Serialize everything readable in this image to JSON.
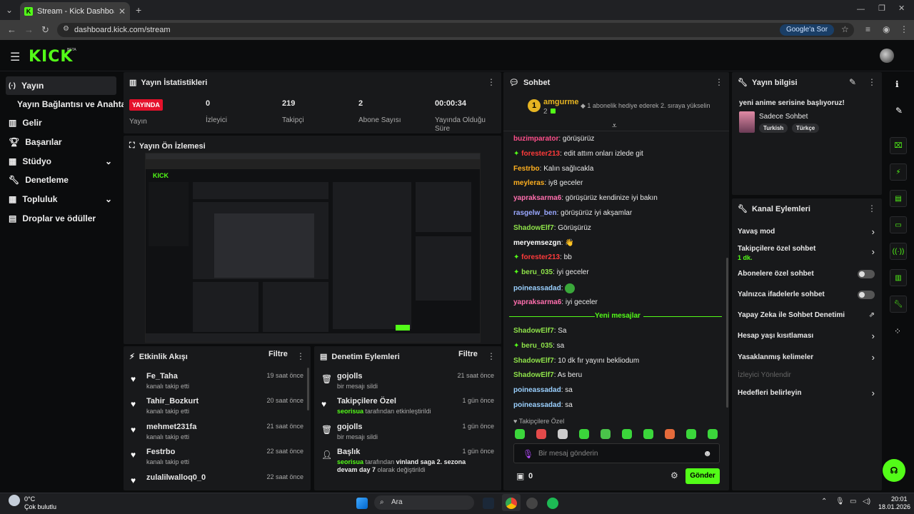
{
  "browser": {
    "tab_title": "Stream - Kick Dashboard",
    "url": "dashboard.kick.com/stream",
    "google_btn": "Google'a Sor"
  },
  "brand": {
    "logo": "KICK",
    "beta": "BETA",
    "accent": "#53fc18"
  },
  "sidebar": {
    "items": [
      {
        "label": "Yayın",
        "icon": "broadcast-icon"
      },
      {
        "label": "Yayın Bağlantısı ve Anahtarı",
        "icon": ""
      },
      {
        "label": "Gelir",
        "icon": "chart-icon"
      },
      {
        "label": "Başarılar",
        "icon": "trophy-icon"
      },
      {
        "label": "Stüdyo",
        "icon": "grid-icon"
      },
      {
        "label": "Denetleme",
        "icon": "wrench-icon"
      },
      {
        "label": "Topluluk",
        "icon": "grid-icon"
      },
      {
        "label": "Droplar ve ödüller",
        "icon": "gift-icon"
      }
    ]
  },
  "stats": {
    "title": "Yayın İstatistikleri",
    "live": "YAYINDA",
    "live_label": "Yayın",
    "viewers": "0",
    "viewers_label": "İzleyici",
    "followers": "219",
    "followers_label": "Takipçi",
    "subs": "2",
    "subs_label": "Abone Sayısı",
    "uptime": "00:00:34",
    "uptime_label": "Yayında Olduğu Süre"
  },
  "preview": {
    "title": "Yayın Ön İzlemesi"
  },
  "activity": {
    "title": "Etkinlik Akışı",
    "filter": "Filtre",
    "items": [
      {
        "name": "Fe_Taha",
        "action": "kanalı takip etti",
        "time": "19 saat önce"
      },
      {
        "name": "Tahir_Bozkurt",
        "action": "kanalı takip etti",
        "time": "20 saat önce"
      },
      {
        "name": "mehmet231fa",
        "action": "kanalı takip etti",
        "time": "21 saat önce"
      },
      {
        "name": "Festrbo",
        "action": "kanalı takip etti",
        "time": "22 saat önce"
      },
      {
        "name": "zulalilwalloq0_0",
        "action": "",
        "time": "22 saat önce"
      }
    ]
  },
  "mod": {
    "title": "Denetim Eylemleri",
    "filter": "Filtre",
    "items": [
      {
        "name": "gojolls",
        "detail": "bir mesajı sildi",
        "time": "21 saat önce",
        "icon": "trash-icon"
      },
      {
        "name": "Takipçilere Özel",
        "who": "seorisua",
        "detail": "tarafından etkinleştirildi",
        "time": "1 gün önce",
        "icon": "heart-icon"
      },
      {
        "name": "gojolls",
        "detail": "bir mesajı sildi",
        "time": "1 gün önce",
        "icon": "trash-icon"
      },
      {
        "name": "Başlık",
        "who": "seorisua",
        "detail": "tarafından",
        "bold": "vinland saga 2. sezona devam day 7",
        "detail2": "olarak değiştirildi",
        "time": "1 gün önce",
        "icon": "user-edit-icon"
      }
    ]
  },
  "chat": {
    "title": "Sohbet",
    "pinned_user": "amgurme",
    "pinned_rank": "1",
    "pinned_count": "2",
    "pinned_text": "1 abonelik hediye ederek 2. sıraya yükselin",
    "new_messages": "Yeni mesajlar",
    "followers_only": "Takipçilere Özel",
    "placeholder": "Bir mesaj gönderin",
    "points": "0",
    "send": "Gönder",
    "messages": [
      {
        "user": "buzimparator",
        "color": "#ff4f8b",
        "text": "görüşürüz"
      },
      {
        "user": "forester213",
        "color": "#ff3b3b",
        "text": "edit attım onları izlede git",
        "badge": true
      },
      {
        "user": "Festrbo",
        "color": "#ffb020",
        "text": "Kalın sağlıcakla"
      },
      {
        "user": "meyleras",
        "color": "#ffb020",
        "text": "iy8 geceler"
      },
      {
        "user": "yapraksarma6",
        "color": "#ff6fae",
        "text": "görüşürüz kendinize iyi bakın"
      },
      {
        "user": "rasgelw_ben",
        "color": "#9aa8ff",
        "text": "görüşürüz iyi akşamlar"
      },
      {
        "user": "ShadowElf7",
        "color": "#8fe34a",
        "text": "Görüşürüz"
      },
      {
        "user": "meryemsezgn",
        "color": "#ffffff",
        "text": "👋"
      },
      {
        "user": "forester213",
        "color": "#ff3b3b",
        "text": "bb",
        "badge": true
      },
      {
        "user": "beru_035",
        "color": "#8fe34a",
        "text": "iyi geceler",
        "badge": true
      },
      {
        "user": "poineassadad",
        "color": "#9ad0ff",
        "text": "",
        "emote": true
      },
      {
        "user": "yapraksarma6",
        "color": "#ff6fae",
        "text": "iyi geceler"
      }
    ],
    "new": [
      {
        "user": "ShadowElf7",
        "color": "#8fe34a",
        "text": "Sa"
      },
      {
        "user": "beru_035",
        "color": "#8fe34a",
        "text": "sa",
        "badge": true
      },
      {
        "user": "ShadowElf7",
        "color": "#8fe34a",
        "text": "10 dk fır yayını bekliodum"
      },
      {
        "user": "ShadowElf7",
        "color": "#8fe34a",
        "text": "As beru"
      },
      {
        "user": "poineassadad",
        "color": "#9ad0ff",
        "text": "sa"
      },
      {
        "user": "poineassadad",
        "color": "#9ad0ff",
        "text": "sa"
      }
    ]
  },
  "info": {
    "title": "Yayın bilgisi",
    "stream_title": "yeni anime serisine başlıyoruz!",
    "category": "Sadece Sohbet",
    "tags": [
      "Turkish",
      "Türkçe"
    ]
  },
  "channel": {
    "title": "Kanal Eylemleri",
    "items": [
      {
        "label": "Yavaş mod",
        "type": "chev"
      },
      {
        "label": "Takipçilere özel sohbet",
        "sub": "1 dk.",
        "type": "chev"
      },
      {
        "label": "Abonelere özel sohbet",
        "type": "toggle"
      },
      {
        "label": "Yalnızca ifadelerle sohbet",
        "type": "toggle"
      },
      {
        "label": "Yapay Zeka ile Sohbet Denetimi",
        "type": "ext"
      },
      {
        "label": "Hesap yaşı kısıtlaması",
        "type": "chev"
      },
      {
        "label": "Yasaklanmış kelimeler",
        "type": "chev"
      },
      {
        "label": "İzleyici Yönlendir",
        "type": "disabled"
      },
      {
        "label": "Hedefleri belirleyin",
        "type": "chev"
      }
    ]
  },
  "taskbar": {
    "weather_temp": "0°C",
    "weather_desc": "Çok bulutlu",
    "search": "Ara",
    "time": "20:01",
    "date": "18.01.2026"
  }
}
